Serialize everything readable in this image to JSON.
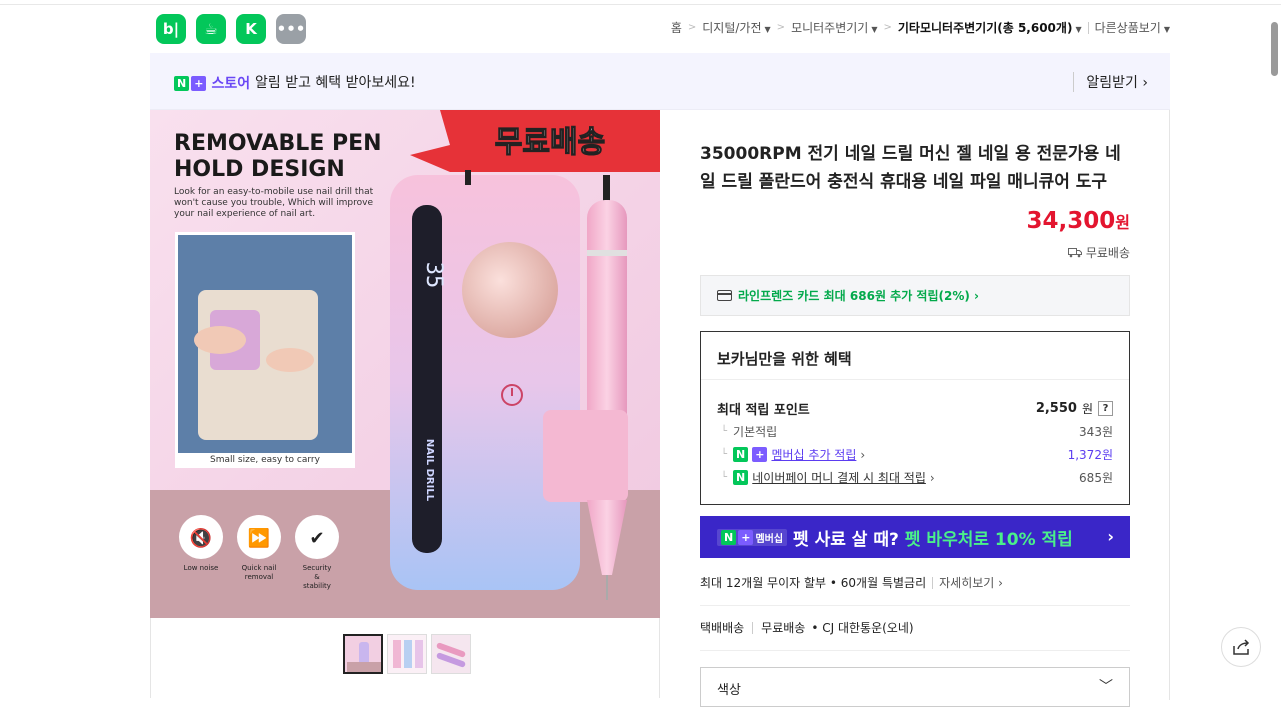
{
  "header": {
    "app_icons": [
      {
        "name": "blog-icon",
        "glyph": "b|"
      },
      {
        "name": "cafe-icon",
        "glyph": "☕"
      },
      {
        "name": "navigate-icon",
        "glyph": "K"
      },
      {
        "name": "more-icon",
        "glyph": "•••"
      }
    ],
    "breadcrumb": {
      "home": "홈",
      "cat1": "디지털/가전",
      "cat2": "모니터주변기기",
      "cat3": "기타모니터주변기기(총 5,600개)",
      "other": "다른상품보기"
    }
  },
  "banner": {
    "store_label": "스토어",
    "message": "알림 받고 혜택 받아보세요!",
    "alarm_button": "알림받기 ›"
  },
  "image": {
    "headline1": "REMOVABLE PEN",
    "headline2": "HOLD DESIGN",
    "free_ship_badge": "무료배송",
    "desc1": "Look for an easy-to-mobile use nail drill that",
    "desc2": "won't cause you trouble, Which will improve",
    "desc3": "your nail experience of nail art.",
    "photo_caption": "Small size, easy to carry",
    "display_value": "35",
    "device_label": "NAIL DRILL",
    "feature1": "Low noise",
    "feature2a": "Quick nail",
    "feature2b": "removal",
    "feature3a": "Security",
    "feature3b": "&",
    "feature3c": "stability"
  },
  "product": {
    "title": "35000RPM 전기 네일 드릴 머신 젤 네일 용 전문가용 네일 드릴 폴란드어 충전식 휴대용 네일 파일 매니큐어 도구",
    "price": "34,300",
    "price_unit": "원",
    "shipping": "무료배송",
    "card_benefit": "라인프렌즈 카드 최대 686원 추가 적립(2%) ›"
  },
  "benefit": {
    "title": "보카님만을 위한 혜택",
    "max_points_label": "최대 적립 포인트",
    "max_points_value": "2,550",
    "unit": "원",
    "help": "?",
    "basic_label": "기본적립",
    "basic_value": "343원",
    "membership_label": "멤버십 추가 적립",
    "membership_value": "1,372원",
    "pay_label": "네이버페이 머니 결제 시 최대 적립",
    "pay_value": "685원"
  },
  "pet_banner": {
    "badge": "멤버십",
    "text1": "펫 사료 살 때?",
    "text2": "펫 바우처로 10% 적립",
    "chevron": "›"
  },
  "installment": {
    "text": "최대 12개월 무이자 할부 • 60개월 특별금리",
    "more": "자세히보기 ›"
  },
  "delivery": {
    "type": "택배배송",
    "fee": "무료배송",
    "carrier": "• CJ 대한통운(오네)"
  },
  "option": {
    "label": "색상",
    "chevron": "﹀"
  },
  "colors": {
    "naver_green": "#03c75a",
    "price_red": "#e3152f",
    "pet_banner_bg": "#3a26c8",
    "membership_purple": "#5b3cf0"
  }
}
